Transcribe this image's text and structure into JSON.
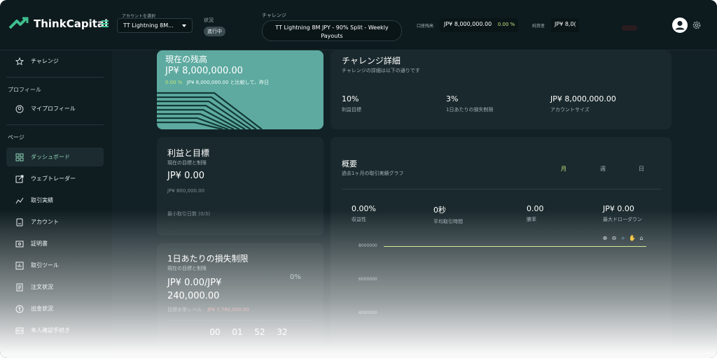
{
  "header": {
    "brand": "ThinkCapital",
    "account_label": "アカウントを選択",
    "account_value": "TT Lightning 8M...",
    "status_label": "状況",
    "status_value": "進行中",
    "challenge_label": "チャレンジ",
    "challenge_value": "TT Lightning 8M JPY - 90% Split - Weekly Payouts",
    "balance_label": "口座残高",
    "balance_value": "JP¥ 8,000,000.00",
    "balance_pct": "0.00 %",
    "equity_label": "純資産",
    "equity_value": "JP¥ 8,0("
  },
  "sidebar": {
    "challenge": "チャレンジ",
    "profile_section": "プロフィール",
    "my_profile": "マイプロフィール",
    "pages_section": "ページ",
    "items": [
      {
        "label": "ダッシュボード",
        "icon": "dashboard-icon"
      },
      {
        "label": "ウェブトレーダー",
        "icon": "external-link-icon"
      },
      {
        "label": "取引実績",
        "icon": "chart-line-icon"
      },
      {
        "label": "アカウント",
        "icon": "account-icon"
      },
      {
        "label": "証明書",
        "icon": "certificate-icon"
      },
      {
        "label": "取引ツール",
        "icon": "tools-icon"
      },
      {
        "label": "注文状況",
        "icon": "orders-icon"
      },
      {
        "label": "出金状況",
        "icon": "withdraw-icon"
      },
      {
        "label": "本人確認手続き",
        "icon": "id-icon"
      }
    ]
  },
  "balance_card": {
    "title": "現在の残高",
    "value": "JP¥ 8,000,000.00",
    "pct": "0.00 %",
    "compare": "JP¥ 8,000,000.00 と比較して、昨日"
  },
  "detail_card": {
    "title": "チャレンジ詳細",
    "subtitle": "チャレンジの詳細は以下の通りです",
    "stats": [
      {
        "value": "10%",
        "label": "利益目標"
      },
      {
        "value": "3%",
        "label": "1日あたりの損失制限"
      },
      {
        "value": "JP¥ 8,000,000.00",
        "label": "アカウントサイズ"
      }
    ]
  },
  "profit_card": {
    "title": "利益と目標",
    "subtitle": "現在の目標と制限",
    "value": "JP¥ 0.00",
    "target": "JP¥ 800,000.00",
    "min_days": "最小取引日数 (0/3)"
  },
  "loss_card": {
    "title": "1日あたりの損失制限",
    "subtitle": "現在の目標と制限",
    "value": "JP¥ 0.00/JP¥ 240,000.00",
    "pct": "0%",
    "level_label": "目標水準レベル",
    "level_value": "JP¥ 7,760,000.00",
    "timer": [
      "00",
      "01",
      "52",
      "32"
    ]
  },
  "overview_card": {
    "title": "概要",
    "subtitle": "過去1ヶ月の取引実績グラフ",
    "tabs": [
      "月",
      "週",
      "日"
    ],
    "stats": [
      {
        "value": "0.00%",
        "label": "収益性"
      },
      {
        "value": "0秒",
        "label": "平均取引時間"
      },
      {
        "value": "0.00",
        "label": "勝率"
      },
      {
        "value": "JP¥ 0.00",
        "label": "最大ドローダウン"
      }
    ],
    "yticks": [
      "8000000",
      "6000000",
      "4000000"
    ]
  },
  "colors": {
    "accent": "#c2e57d",
    "brand_green": "#3fbf8f",
    "balance_card": "#5eaaa0"
  }
}
